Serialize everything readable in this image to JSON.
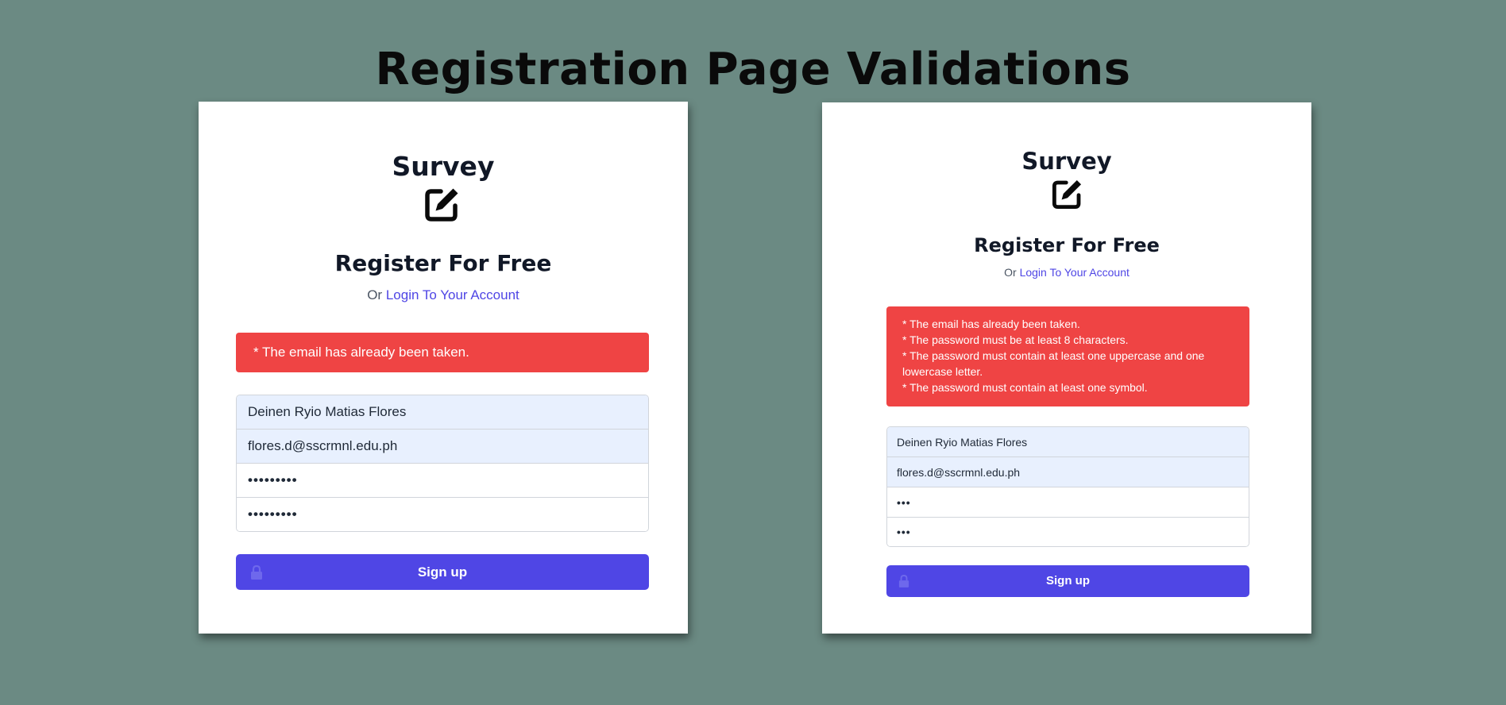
{
  "page_title": "Registration Page Validations",
  "colors": {
    "background": "#6b8a83",
    "accent": "#4f46e5",
    "error": "#ef4444",
    "autofill": "#e8f0fe"
  },
  "cards": [
    {
      "brand": "Survey",
      "brand_icon": "edit-icon",
      "heading": "Register For Free",
      "subline_prefix": "Or",
      "login_link": "Login To Your Account",
      "errors": [
        "* The email has already been taken."
      ],
      "fields": {
        "full_name": "Deinen Ryio Matias Flores",
        "email": "flores.d@sscrmnl.edu.ph",
        "password": "•••••••••",
        "password_confirmation": "•••••••••"
      },
      "button_label": "Sign up",
      "button_icon": "lock-icon"
    },
    {
      "brand": "Survey",
      "brand_icon": "edit-icon",
      "heading": "Register For Free",
      "subline_prefix": "Or",
      "login_link": "Login To Your Account",
      "errors": [
        "* The email has already been taken.",
        "* The password must be at least 8 characters.",
        "* The password must contain at least one uppercase and one lowercase letter.",
        "* The password must contain at least one symbol."
      ],
      "fields": {
        "full_name": "Deinen Ryio Matias Flores",
        "email": "flores.d@sscrmnl.edu.ph",
        "password": "•••",
        "password_confirmation": "•••"
      },
      "button_label": "Sign up",
      "button_icon": "lock-icon"
    }
  ]
}
